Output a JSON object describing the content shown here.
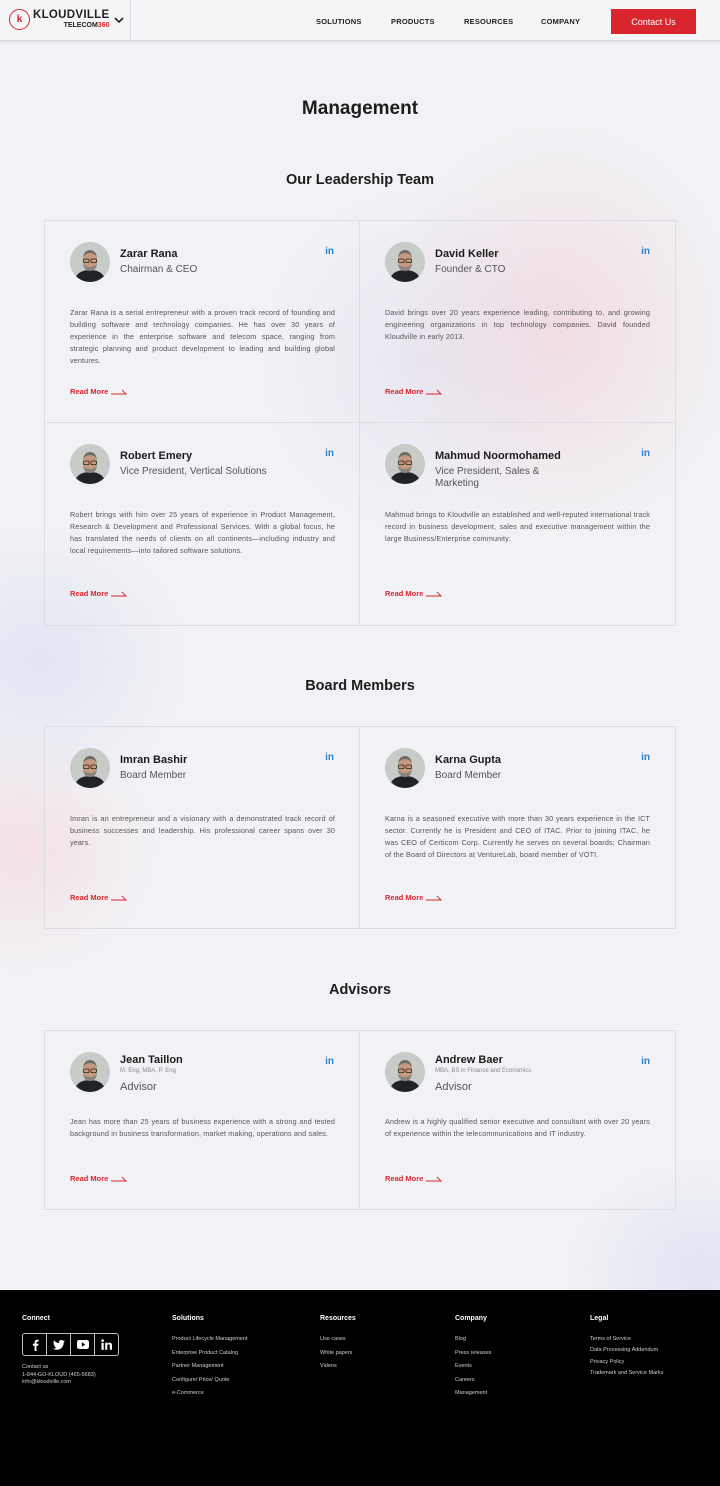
{
  "header": {
    "logo_mark": "k",
    "logo_main": "KLOUDVILLE",
    "logo_sub_a": "TELECOM",
    "logo_sub_b": "360",
    "nav": [
      "SOLUTIONS",
      "PRODUCTS",
      "RESOURCES",
      "COMPANY"
    ],
    "contact_label": "Contact Us"
  },
  "page_title": "Management",
  "leadership": {
    "title": "Our Leadership Team",
    "members": [
      {
        "name": "Zarar Rana",
        "role": "Chairman & CEO",
        "bio": "Zarar Rana is a serial entrepreneur with a proven track record of founding and building software and technology companies. He has over 30 years of experience in the enterprise software and telecom space, ranging from strategic planning and product development to leading and building global ventures."
      },
      {
        "name": "David Keller",
        "role": "Founder & CTO",
        "bio": "David brings over 20 years experience leading, contributing to, and growing engineering organizations in top technology companies. David founded Kloudville in early 2013."
      },
      {
        "name": "Robert Emery",
        "role": "Vice President, Vertical Solutions",
        "bio": "Robert brings with him over 25 years of experience in Product Management, Research & Development and Professional Services. With a global focus, he has translated the needs of clients on all continents—including industry and local requirements—into tailored software solutions."
      },
      {
        "name": "Mahmud Noormohamed",
        "role": "Vice President, Sales & Marketing",
        "bio": "Mahmud brings to Kloudville an established and well-reputed international track record in business development, sales and executive management within the large Business/Enterprise community."
      }
    ]
  },
  "board": {
    "title": "Board Members",
    "members": [
      {
        "name": "Imran Bashir",
        "role": "Board Member",
        "bio": "Imran is an entrepreneur and a visionary with a demonstrated track record of business successes and leadership. His professional career spans over 30 years."
      },
      {
        "name": "Karna Gupta",
        "role": "Board Member",
        "bio": "Karna is a seasoned executive with more than 30 years experience in the ICT sector. Currently he is President and CEO of ITAC. Prior to joining ITAC, he was CEO of Certicom Corp. Currently he serves on several boards; Chairman of the Board of Directors at VentureLab, board member of VOTI."
      }
    ]
  },
  "advisors": {
    "title": "Advisors",
    "members": [
      {
        "name": "Jean Taillon",
        "credentials": "M. Eng, MBA, P. Eng",
        "role": "Advisor",
        "bio": "Jean has more than 25 years of business experience with a strong and tested background in business transformation, market making, operations and sales."
      },
      {
        "name": "Andrew Baer",
        "credentials": "MBA, BS in Finance and Economics",
        "role": "Advisor",
        "bio": "Andrew is a highly qualified senior executive and consultant with over 20 years of experience within the telecommunications and IT industry."
      }
    ]
  },
  "common": {
    "read_more": "Read More",
    "linkedin": "in"
  },
  "footer": {
    "connect": {
      "heading": "Connect",
      "contact_label": "Contact us",
      "phone": "1-844-GO-KLOUD (465-5683)",
      "email": "info@kloudville.com"
    },
    "solutions": {
      "heading": "Solutions",
      "links": [
        "Product Lifecycle Management",
        "Enterprise Product Catalog",
        "Partner Management",
        "Configure/ Price/ Quote",
        "e-Commerce"
      ]
    },
    "resources": {
      "heading": "Resources",
      "links": [
        "Use cases",
        "White papers",
        "Videos"
      ]
    },
    "company": {
      "heading": "Company",
      "links": [
        "Blog",
        "Press releases",
        "Events",
        "Careers",
        "Management"
      ]
    },
    "legal": {
      "heading": "Legal",
      "links": [
        "Terms of Service",
        "Data Processing Addendum",
        "Privacy Policy",
        "Trademark and Service Marks"
      ]
    }
  },
  "colors": {
    "accent": "#d9262e",
    "linkedin": "#2f82c8",
    "background": "#f1f2f5",
    "footer": "#000000"
  }
}
